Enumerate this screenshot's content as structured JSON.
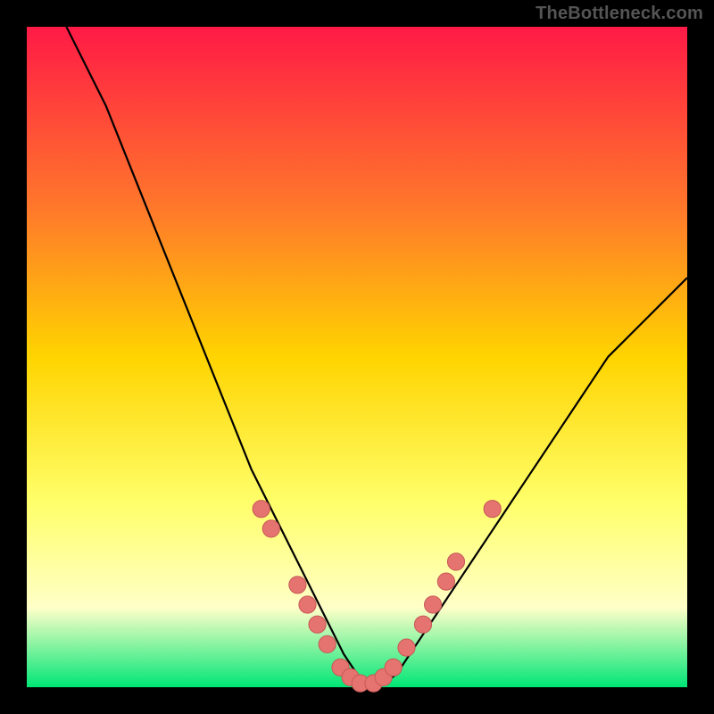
{
  "watermark": "TheBottleneck.com",
  "colors": {
    "background": "#000000",
    "gradient_top": "#ff1a46",
    "gradient_mid_upper": "#ff7a2a",
    "gradient_mid": "#ffd400",
    "gradient_lower": "#ffff6a",
    "gradient_pale": "#ffffc8",
    "gradient_bottom": "#00e676",
    "curve": "#000000",
    "marker_fill": "#e5736f",
    "marker_stroke": "#c75a57"
  },
  "chart_data": {
    "type": "line",
    "title": "",
    "xlabel": "",
    "ylabel": "",
    "xlim": [
      0,
      100
    ],
    "ylim": [
      0,
      100
    ],
    "series": [
      {
        "name": "bottleneck-curve",
        "x": [
          6,
          8,
          10,
          12,
          14,
          16,
          18,
          20,
          22,
          24,
          26,
          28,
          30,
          32,
          34,
          36,
          38,
          40,
          42,
          44,
          46,
          48,
          50,
          52,
          54,
          56,
          58,
          60,
          62,
          64,
          66,
          68,
          70,
          72,
          74,
          76,
          78,
          80,
          82,
          84,
          86,
          88,
          90,
          92,
          94,
          96,
          98,
          100
        ],
        "values": [
          100,
          96,
          92,
          88,
          83,
          78,
          73,
          68,
          63,
          58,
          53,
          48,
          43,
          38,
          33,
          29,
          25,
          21,
          17,
          13,
          9,
          5,
          2,
          0.5,
          0.5,
          2,
          5,
          8,
          11,
          14,
          17,
          20,
          23,
          26,
          29,
          32,
          35,
          38,
          41,
          44,
          47,
          50,
          52,
          54,
          56,
          58,
          60,
          62
        ]
      }
    ],
    "markers": [
      {
        "x": 35.5,
        "y": 27
      },
      {
        "x": 37.0,
        "y": 24
      },
      {
        "x": 41.0,
        "y": 15.5
      },
      {
        "x": 42.5,
        "y": 12.5
      },
      {
        "x": 44.0,
        "y": 9.5
      },
      {
        "x": 45.5,
        "y": 6.5
      },
      {
        "x": 47.5,
        "y": 3.0
      },
      {
        "x": 49.0,
        "y": 1.5
      },
      {
        "x": 50.5,
        "y": 0.6
      },
      {
        "x": 52.5,
        "y": 0.6
      },
      {
        "x": 54.0,
        "y": 1.5
      },
      {
        "x": 55.5,
        "y": 3.0
      },
      {
        "x": 57.5,
        "y": 6.0
      },
      {
        "x": 60.0,
        "y": 9.5
      },
      {
        "x": 61.5,
        "y": 12.5
      },
      {
        "x": 63.5,
        "y": 16.0
      },
      {
        "x": 65.0,
        "y": 19.0
      },
      {
        "x": 70.5,
        "y": 27.0
      }
    ],
    "marker_radius": 1.3
  }
}
